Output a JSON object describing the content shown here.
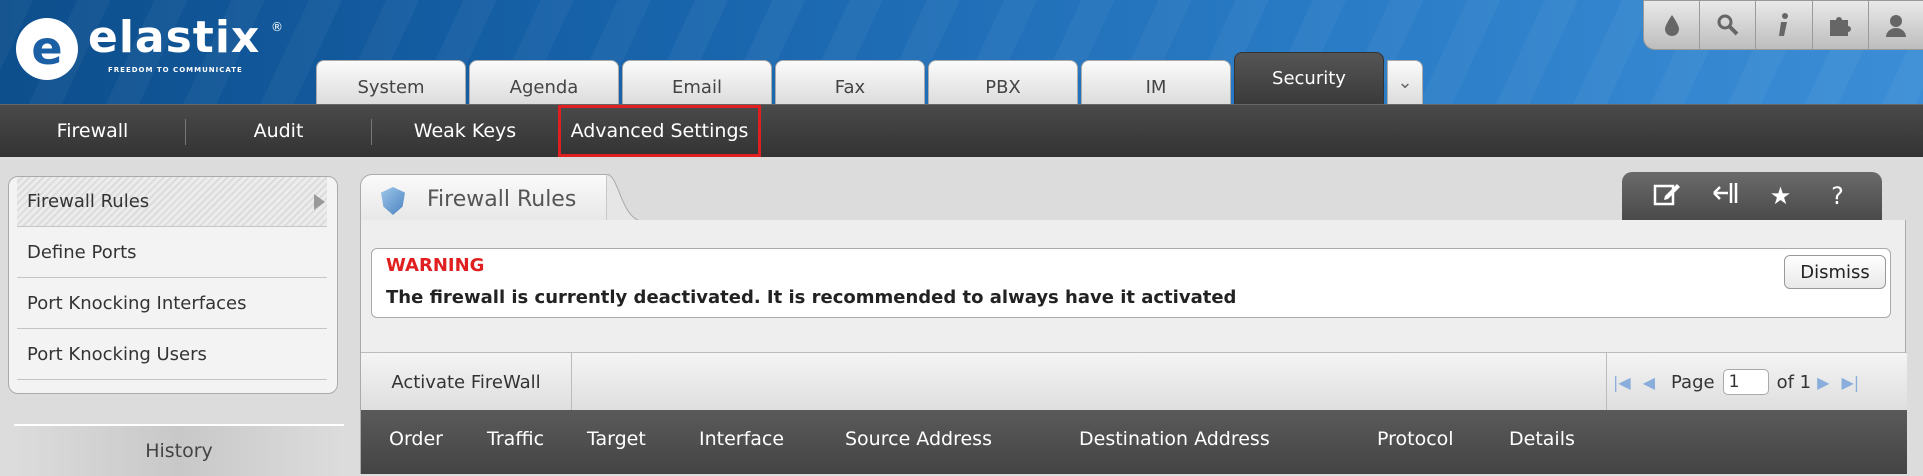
{
  "logo": {
    "name": "elastix",
    "registered": "®",
    "tagline": "FREEDOM TO COMMUNICATE"
  },
  "top_icons": [
    "theme-icon",
    "search-icon",
    "info-icon",
    "addons-icon",
    "user-icon"
  ],
  "tabs": [
    {
      "label": "System"
    },
    {
      "label": "Agenda"
    },
    {
      "label": "Email"
    },
    {
      "label": "Fax"
    },
    {
      "label": "PBX"
    },
    {
      "label": "IM"
    },
    {
      "label": "Security",
      "active": true
    }
  ],
  "submenu": [
    {
      "label": "Firewall"
    },
    {
      "label": "Audit"
    },
    {
      "label": "Weak Keys"
    },
    {
      "label": "Advanced Settings",
      "highlighted": true
    }
  ],
  "sidebar": {
    "items": [
      {
        "label": "Firewall Rules",
        "active": true
      },
      {
        "label": "Define Ports"
      },
      {
        "label": "Port Knocking Interfaces"
      },
      {
        "label": "Port Knocking Users"
      }
    ],
    "history_label": "History"
  },
  "main": {
    "title": "Firewall Rules",
    "tools": [
      "edit-icon",
      "collapse-icon",
      "star-icon",
      "help-icon"
    ],
    "warning": {
      "title": "WARNING",
      "message": "The firewall is currently deactivated. It is recommended to always have it activated",
      "dismiss_label": "Dismiss"
    },
    "toolbar": {
      "activate_label": "Activate FireWall",
      "page_label": "Page",
      "page_value": "1",
      "of_label": "of 1"
    },
    "table_headers": [
      "Order",
      "Traffic",
      "Target",
      "Interface",
      "Source Address",
      "Destination Address",
      "Protocol",
      "Details"
    ]
  },
  "colors": {
    "header_blue": "#1661a8",
    "highlight": "#e02020",
    "warning": "#e02020"
  }
}
